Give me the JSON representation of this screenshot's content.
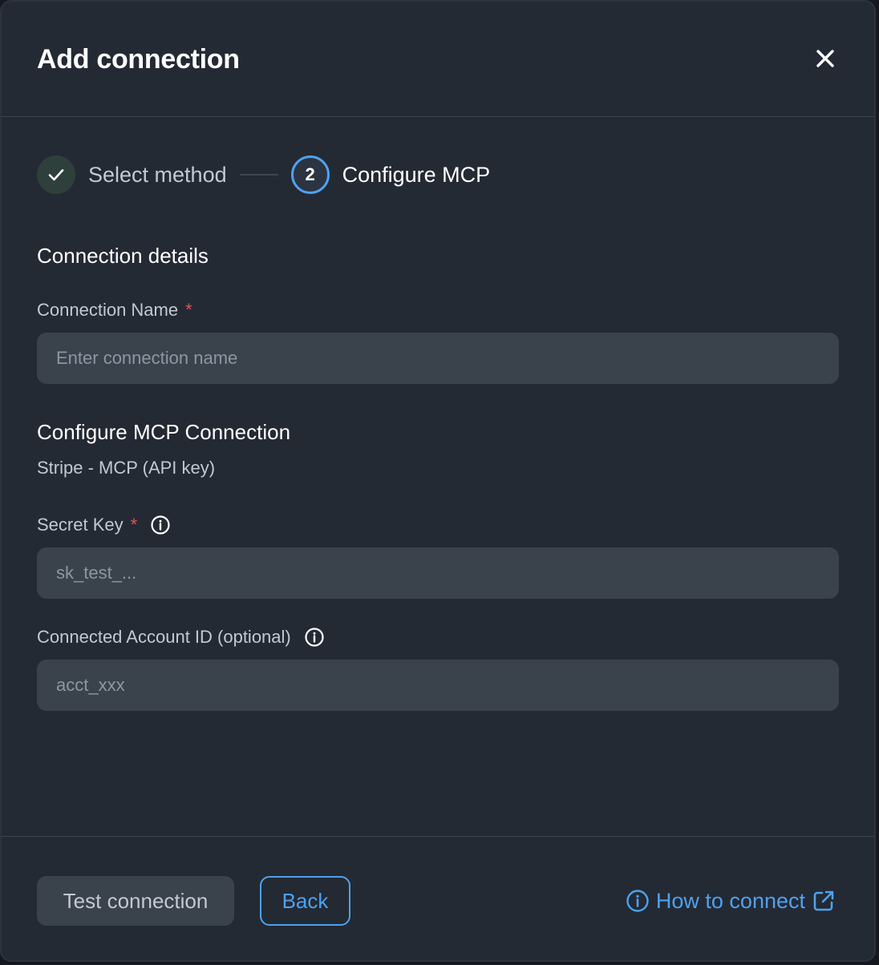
{
  "dialog": {
    "title": "Add connection",
    "close_icon": "close-icon"
  },
  "stepper": {
    "steps": [
      {
        "label": "Select method",
        "state": "completed",
        "icon": "check-icon"
      },
      {
        "label": "Configure MCP",
        "state": "active",
        "number": "2"
      }
    ]
  },
  "connection_details": {
    "heading": "Connection details",
    "name_label": "Connection Name",
    "required_mark": "*",
    "name_placeholder": "Enter connection name",
    "name_value": ""
  },
  "mcp_config": {
    "heading": "Configure MCP Connection",
    "subtitle": "Stripe - MCP (API key)",
    "secret_key_label": "Secret Key",
    "secret_key_placeholder": "sk_test_...",
    "account_id_label": "Connected Account ID (optional)",
    "account_id_placeholder": "acct_xxx"
  },
  "footer": {
    "test_label": "Test connection",
    "back_label": "Back",
    "how_to_label": "How to connect",
    "how_to_icons": [
      "info-icon",
      "external-link-icon"
    ]
  },
  "colors": {
    "background": "#232a34",
    "accent": "#4fa1ef",
    "input_bg": "#3a424c",
    "required": "#e5534b",
    "success_circle": "#2f3f3b"
  }
}
